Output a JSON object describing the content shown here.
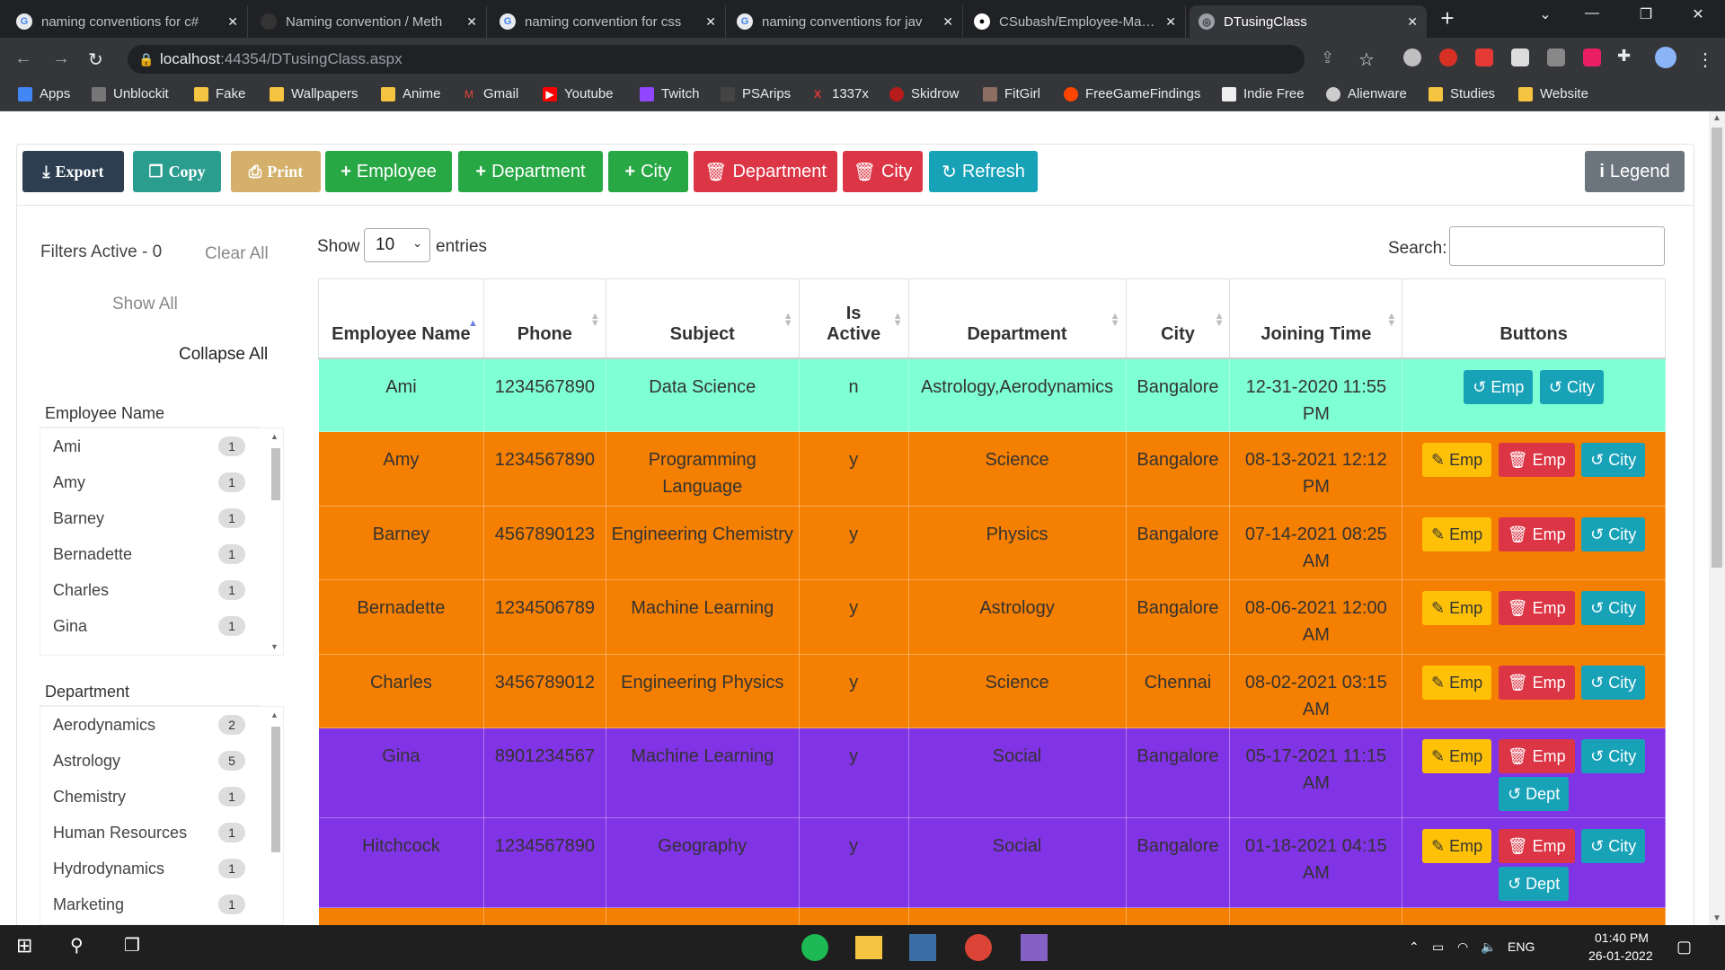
{
  "browser": {
    "tabs": [
      {
        "title": "naming conventions for c#",
        "icon": "google-icon"
      },
      {
        "title": "Naming convention / Meth",
        "icon": "page-icon"
      },
      {
        "title": "naming convention for css",
        "icon": "google-icon"
      },
      {
        "title": "naming conventions for jav",
        "icon": "google-icon"
      },
      {
        "title": "CSubash/Employee-Manag",
        "icon": "github-icon"
      },
      {
        "title": "DTusingClass",
        "icon": "globe-icon"
      }
    ],
    "url_host": "localhost",
    "url_path": ":44354/DTusingClass.aspx",
    "bookmarks": [
      "Apps",
      "Unblockit",
      "Fake",
      "Wallpapers",
      "Anime",
      "Gmail",
      "Youtube",
      "Twitch",
      "PSArips",
      "1337x",
      "Skidrow",
      "FitGirl",
      "FreeGameFindings",
      "Indie Free",
      "Alienware",
      "Studies",
      "Website"
    ]
  },
  "toolbar": {
    "export": "Export",
    "copy": "Copy",
    "print": "Print",
    "add_employee": "Employee",
    "add_department": "Department",
    "add_city": "City",
    "del_department": "Department",
    "del_city": "City",
    "refresh": "Refresh",
    "legend": "Legend"
  },
  "filters": {
    "active_label": "Filters Active - 0",
    "clear_all": "Clear All",
    "show_all": "Show All",
    "collapse_all": "Collapse All",
    "employee_header": "Employee Name",
    "employees": [
      {
        "name": "Ami",
        "count": "1"
      },
      {
        "name": "Amy",
        "count": "1"
      },
      {
        "name": "Barney",
        "count": "1"
      },
      {
        "name": "Bernadette",
        "count": "1"
      },
      {
        "name": "Charles",
        "count": "1"
      },
      {
        "name": "Gina",
        "count": "1"
      }
    ],
    "department_header": "Department",
    "departments": [
      {
        "name": "Aerodynamics",
        "count": "2"
      },
      {
        "name": "Astrology",
        "count": "5"
      },
      {
        "name": "Chemistry",
        "count": "1"
      },
      {
        "name": "Human Resources",
        "count": "1"
      },
      {
        "name": "Hydrodynamics",
        "count": "1"
      },
      {
        "name": "Marketing",
        "count": "1"
      }
    ]
  },
  "table_controls": {
    "show": "Show",
    "entries_value": "10",
    "entries": "entries",
    "search_label": "Search:"
  },
  "table": {
    "headers": [
      "Employee Name",
      "Phone",
      "Subject",
      "Is Active",
      "Department",
      "City",
      "Joining Time",
      "Buttons"
    ],
    "rows": [
      {
        "name": "Ami",
        "phone": "1234567890",
        "subject": "Data Science",
        "active": "n",
        "department": "Astrology,Aerodynamics",
        "city": "Bangalore",
        "joined": "12-31-2020 11:55 PM",
        "style": "teal"
      },
      {
        "name": "Amy",
        "phone": "1234567890",
        "subject": "Programming Language",
        "active": "y",
        "department": "Science",
        "city": "Bangalore",
        "joined": "08-13-2021 12:12 PM",
        "style": "orange"
      },
      {
        "name": "Barney",
        "phone": "4567890123",
        "subject": "Engineering Chemistry",
        "active": "y",
        "department": "Physics",
        "city": "Bangalore",
        "joined": "07-14-2021 08:25 AM",
        "style": "orange"
      },
      {
        "name": "Bernadette",
        "phone": "1234506789",
        "subject": "Machine Learning",
        "active": "y",
        "department": "Astrology",
        "city": "Bangalore",
        "joined": "08-06-2021 12:00 AM",
        "style": "orange"
      },
      {
        "name": "Charles",
        "phone": "3456789012",
        "subject": "Engineering Physics",
        "active": "y",
        "department": "Science",
        "city": "Chennai",
        "joined": "08-02-2021 03:15 AM",
        "style": "orange"
      },
      {
        "name": "Gina",
        "phone": "8901234567",
        "subject": "Machine Learning",
        "active": "y",
        "department": "Social",
        "city": "Bangalore",
        "joined": "05-17-2021 11:15 AM",
        "style": "purple"
      },
      {
        "name": "Hitchcock",
        "phone": "1234567890",
        "subject": "Geography",
        "active": "y",
        "department": "Social",
        "city": "Bangalore",
        "joined": "01-18-2021 04:15 AM",
        "style": "purple"
      }
    ],
    "btn_emp": "Emp",
    "btn_city": "City",
    "btn_dept": "Dept"
  },
  "taskbar": {
    "lang": "ENG",
    "time": "01:40 PM",
    "date": "26-01-2022"
  },
  "colors": {
    "teal_row": "#7fffd4",
    "orange_row": "#f57f00",
    "purple_row": "#8133e6",
    "export": "#2c3e50",
    "copy": "#2a9d8f",
    "print": "#d4b06a",
    "add": "#28a745",
    "delete": "#dc3545",
    "refresh": "#17a2b8",
    "legend": "#6c757d"
  }
}
